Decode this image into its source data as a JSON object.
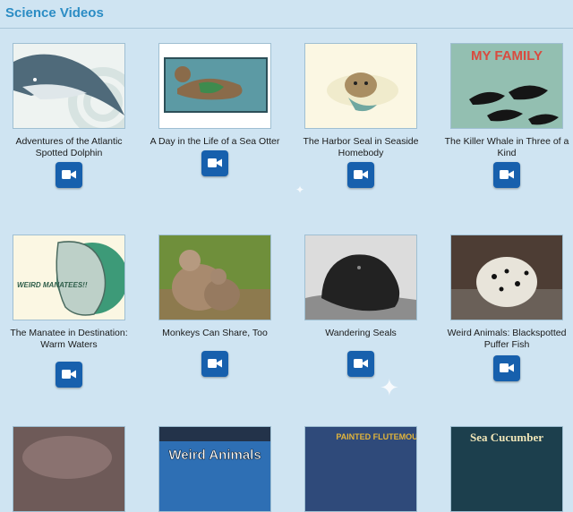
{
  "page": {
    "title": "Science Videos"
  },
  "videos": [
    {
      "title": "Adventures of the Atlantic Spotted Dolphin",
      "thumb": "dolphin"
    },
    {
      "title": "A Day in the Life of a Sea Otter",
      "thumb": "otter"
    },
    {
      "title": "The Harbor Seal in Seaside Homebody",
      "thumb": "seal"
    },
    {
      "title": "The Killer Whale in Three of a Kind",
      "thumb": "orca",
      "thumb_text": "MY FAMILY"
    },
    {
      "title": "The Manatee in Destination: Warm Waters",
      "thumb": "manatee",
      "thumb_text": "WEIRD MANATEES!!"
    },
    {
      "title": "Monkeys Can Share, Too",
      "thumb": "monkeys"
    },
    {
      "title": "Wandering Seals",
      "thumb": "black-seal"
    },
    {
      "title": "Weird Animals: Blackspotted Puffer Fish",
      "thumb": "puffer"
    },
    {
      "title": "",
      "thumb": "coral"
    },
    {
      "title": "",
      "thumb": "weird-animals",
      "thumb_text": "Weird Animals"
    },
    {
      "title": "",
      "thumb": "flutemouth",
      "thumb_text": "PAINTED FLUTEMOUTH"
    },
    {
      "title": "",
      "thumb": "sea-cucumber",
      "thumb_text": "Sea Cucumber"
    }
  ],
  "icons": {
    "video": "video-camera-icon"
  }
}
